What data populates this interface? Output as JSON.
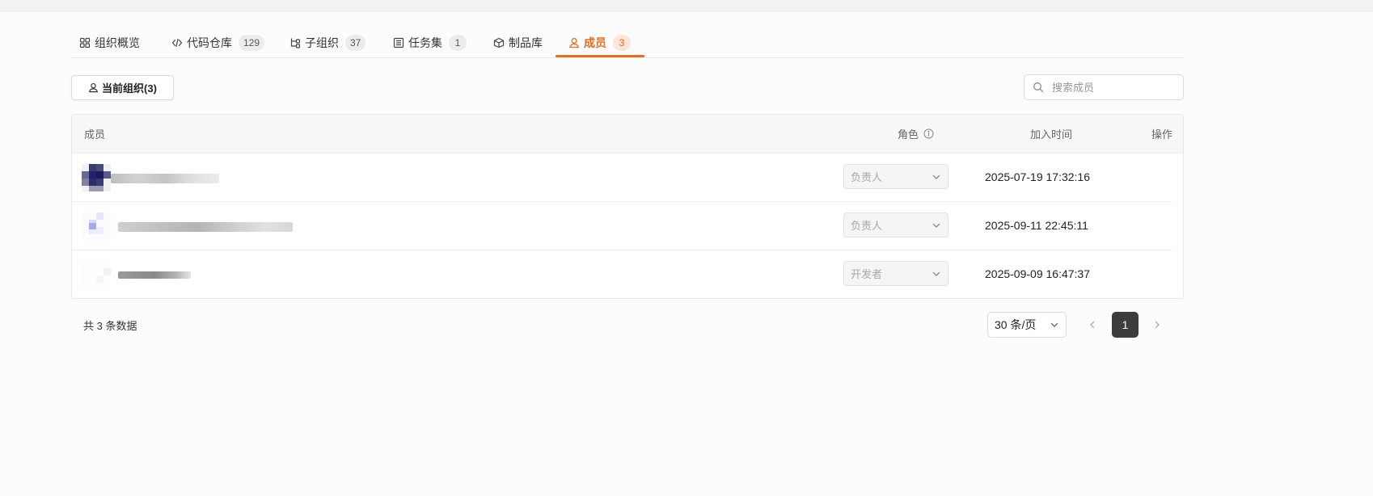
{
  "tabs": [
    {
      "label": "组织概览",
      "icon": "grid-icon",
      "count": null
    },
    {
      "label": "代码仓库",
      "icon": "code-icon",
      "count": "129"
    },
    {
      "label": "子组织",
      "icon": "hierarchy-icon",
      "count": "37"
    },
    {
      "label": "任务集",
      "icon": "list-icon",
      "count": "1"
    },
    {
      "label": "制品库",
      "icon": "box-icon",
      "count": null
    },
    {
      "label": "成员",
      "icon": "user-icon",
      "count": "3",
      "active": true
    }
  ],
  "toolbar": {
    "scope_button": "当前组织(3)",
    "search_placeholder": "搜索成员"
  },
  "table": {
    "columns": {
      "member": "成员",
      "role": "角色",
      "join_time": "加入时间",
      "actions": "操作"
    },
    "rows": [
      {
        "role": "负责人",
        "join_time": "2025-07-19 17:32:16"
      },
      {
        "role": "负责人",
        "join_time": "2025-09-11 22:45:11"
      },
      {
        "role": "开发者",
        "join_time": "2025-09-09 16:47:37"
      }
    ]
  },
  "pagination": {
    "total_text": "共 3 条数据",
    "page_size": "30 条/页",
    "current_page": "1"
  },
  "colors": {
    "accent": "#ea6a1e",
    "active_badge_bg": "#fde6d8",
    "page_active_bg": "#3d3d3d"
  }
}
